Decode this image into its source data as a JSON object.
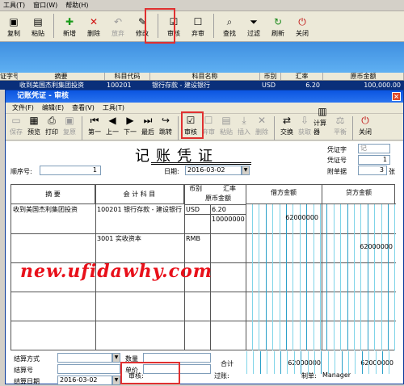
{
  "top_menu": {
    "tools": "工具(T)",
    "window": "窗口(W)",
    "help": "帮助(H)"
  },
  "top_toolbar": [
    {
      "icon": "copy-icon",
      "label": "复制",
      "enabled": true
    },
    {
      "icon": "paste-icon",
      "label": "粘贴",
      "enabled": true
    },
    {
      "icon": "new-icon",
      "label": "新增",
      "enabled": true
    },
    {
      "icon": "delete-icon",
      "label": "删除",
      "enabled": true
    },
    {
      "icon": "undo-icon",
      "label": "放弃",
      "enabled": false
    },
    {
      "icon": "edit-icon",
      "label": "修改",
      "enabled": true
    },
    {
      "icon": "audit-icon",
      "label": "审核",
      "enabled": true
    },
    {
      "icon": "unaudit-icon",
      "label": "弃审",
      "enabled": true
    },
    {
      "icon": "find-icon",
      "label": "查找",
      "enabled": true
    },
    {
      "icon": "filter-icon",
      "label": "过滤",
      "enabled": true
    },
    {
      "icon": "refresh-icon",
      "label": "刷新",
      "enabled": true
    },
    {
      "icon": "close-icon",
      "label": "关闭",
      "enabled": true
    }
  ],
  "list": {
    "headers": [
      "证字号",
      "摘要",
      "科目代码",
      "科目名称",
      "币别",
      "汇率",
      "原币金额"
    ],
    "row": [
      "",
      "收到美国杰利集团投资",
      "100201",
      "银行存款 - 建设银行",
      "USD",
      "6.20",
      "100,000.00"
    ]
  },
  "window": {
    "title": "记账凭证 - 审核",
    "menu": {
      "file": "文件(F)",
      "edit": "编辑(E)",
      "view": "查看(V)",
      "tools": "工具(T)"
    },
    "toolbar": [
      {
        "icon": "save-icon",
        "label": "保存",
        "enabled": false
      },
      {
        "icon": "preview-icon",
        "label": "预览",
        "enabled": true
      },
      {
        "icon": "print-icon",
        "label": "打印",
        "enabled": true
      },
      {
        "icon": "copy-icon",
        "label": "复原",
        "enabled": false
      },
      {
        "icon": "first-icon",
        "label": "第一",
        "enabled": true
      },
      {
        "icon": "prev-icon",
        "label": "上一",
        "enabled": true
      },
      {
        "icon": "next-icon",
        "label": "下一",
        "enabled": true
      },
      {
        "icon": "last-icon",
        "label": "最后",
        "enabled": true
      },
      {
        "icon": "jump-icon",
        "label": "跳转",
        "enabled": true
      },
      {
        "icon": "audit-icon",
        "label": "审核",
        "enabled": true
      },
      {
        "icon": "unaudit-icon",
        "label": "弃审",
        "enabled": false
      },
      {
        "icon": "paste-icon",
        "label": "粘贴",
        "enabled": false
      },
      {
        "icon": "insert-icon",
        "label": "插入",
        "enabled": false
      },
      {
        "icon": "delete-icon",
        "label": "删除",
        "enabled": false
      },
      {
        "icon": "exchange-icon",
        "label": "交换",
        "enabled": true
      },
      {
        "icon": "fetch-icon",
        "label": "获取",
        "enabled": false
      },
      {
        "icon": "calc-icon",
        "label": "计算器",
        "enabled": true
      },
      {
        "icon": "balance-icon",
        "label": "平衡",
        "enabled": false
      },
      {
        "icon": "close-icon",
        "label": "关闭",
        "enabled": true
      }
    ],
    "form": {
      "title": "记账凭证",
      "seq_label": "顺序号:",
      "seq_value": "1",
      "date_label": "日期:",
      "date_value": "2016-03-02",
      "voucher_type_label": "凭证字",
      "voucher_type_value": "记",
      "voucher_no_label": "凭证号",
      "voucher_no_value": "1",
      "attach_label": "附单据",
      "attach_value": "3",
      "attach_unit": "张",
      "col_summary": "摘 要",
      "col_account": "会 计 科 目",
      "col_currency": "币别",
      "col_rate": "汇率",
      "col_orig": "原币金额",
      "col_debit": "借方金额",
      "col_credit": "贷方金额",
      "entries": [
        {
          "summary": "收到美国杰利集团投资",
          "account": "100201 银行存款 - 建设银行",
          "currency": "USD",
          "rate": "6.20",
          "orig": "10000000",
          "debit": "62000000",
          "credit": ""
        },
        {
          "summary": "",
          "account": "3001 实收资本",
          "currency": "RMB",
          "rate": "",
          "orig": "",
          "debit": "",
          "credit": "62000000"
        }
      ],
      "settle_method_label": "结算方式",
      "settle_no_label": "结算号",
      "settle_date_label": "结算日期",
      "settle_date_value": "2016-03-02",
      "qty_label": "数量",
      "price_label": "单价",
      "total_label": "合计",
      "total_debit": "62000000",
      "total_credit": "62000000",
      "audit_label": "审核:",
      "posted_label": "过账:",
      "maker_label": "制单:",
      "maker_value": "Manager"
    },
    "watermark": "new.ufidawhy.com"
  }
}
